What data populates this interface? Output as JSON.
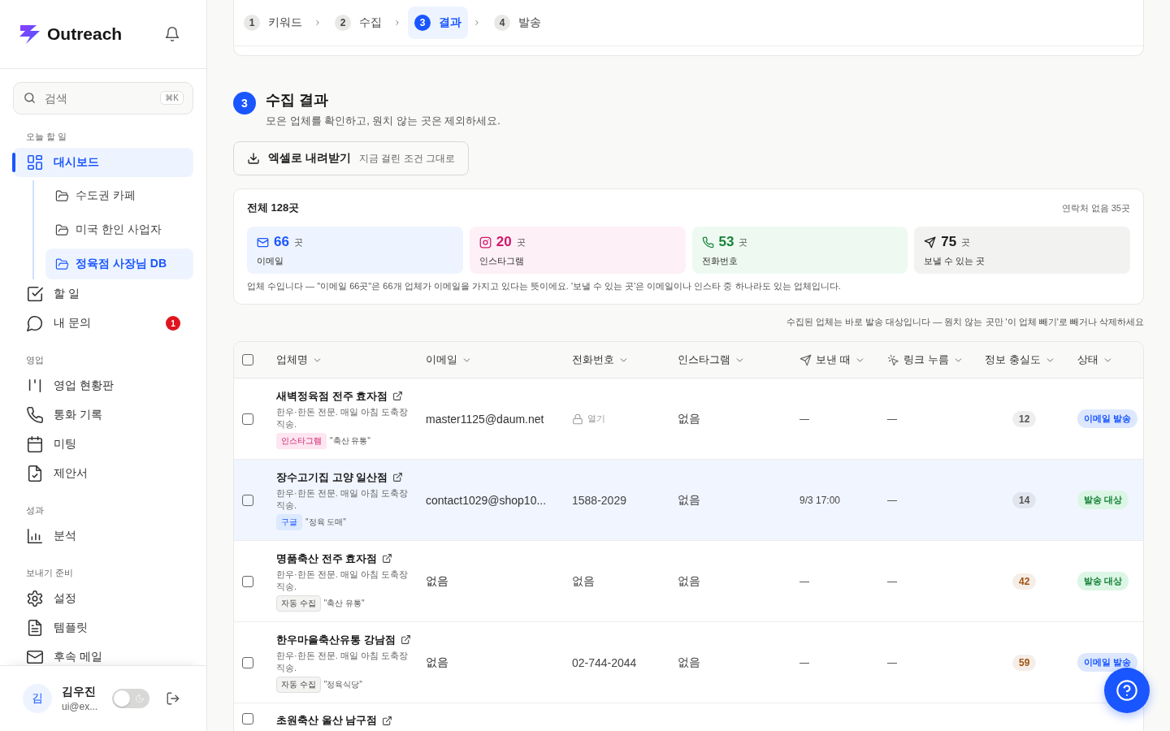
{
  "sidebar": {
    "brand": "Outreach",
    "search": {
      "placeholder": "검색",
      "shortcut": "⌘K"
    },
    "sections": [
      {
        "label": "오늘 할 일",
        "items": [
          {
            "label": "대시보드",
            "selected": true,
            "children": [
              {
                "label": "수도권 카페",
                "selected": false
              },
              {
                "label": "미국 한인 사업자",
                "selected": false
              },
              {
                "label": "정육점 사장님 DB",
                "selected": true
              }
            ]
          },
          {
            "label": "할 일",
            "selected": false
          },
          {
            "label": "내 문의",
            "selected": false,
            "badge": "1"
          }
        ]
      },
      {
        "label": "영업",
        "items": [
          {
            "label": "영업 현황판",
            "selected": false
          },
          {
            "label": "통화 기록",
            "selected": false
          },
          {
            "label": "미팅",
            "selected": false
          },
          {
            "label": "제안서",
            "selected": false
          }
        ]
      },
      {
        "label": "성과",
        "items": [
          {
            "label": "분석",
            "selected": false
          }
        ]
      },
      {
        "label": "보내기 준비",
        "items": [
          {
            "label": "설정",
            "selected": false
          },
          {
            "label": "템플릿",
            "selected": false
          },
          {
            "label": "후속 메일",
            "selected": false
          }
        ]
      }
    ],
    "user": {
      "initial": "김",
      "name": "김우진",
      "email": "ui@ex...",
      "dark_mode": false
    }
  },
  "steps": [
    {
      "number": "1",
      "label": "키워드",
      "selected": false
    },
    {
      "number": "2",
      "label": "수집",
      "selected": false
    },
    {
      "number": "3",
      "label": "결과",
      "selected": true
    },
    {
      "number": "4",
      "label": "발송",
      "selected": false
    }
  ],
  "section": {
    "number": "3",
    "title": "수집 결과",
    "subtitle": "모은 업체를 확인하고, 원치 않는 곳은 제외하세요.",
    "export_button": {
      "label": "엑셀로 내려받기",
      "hint": "지금 걸린 조건 그대로"
    }
  },
  "summary": {
    "title": "전체 128곳",
    "aside": "연락처 없음 35곳",
    "stats": [
      {
        "kind": "email",
        "value": "66",
        "unit": "곳",
        "label": "이메일"
      },
      {
        "kind": "instagram",
        "value": "20",
        "unit": "곳",
        "label": "인스타그램"
      },
      {
        "kind": "phone",
        "value": "53",
        "unit": "곳",
        "label": "전화번호"
      },
      {
        "kind": "send",
        "value": "75",
        "unit": "곳",
        "label": "보낼 수 있는 곳"
      }
    ],
    "note": "업체 수입니다 — \"이메일 66곳\"은 66개 업체가 이메일을 가지고 있다는 뜻이에요. '보낼 수 있는 곳'은 이메일이나 인스타 중 하나라도 있는 업체입니다."
  },
  "table_note": "수집된 업체는 바로 발송 대상입니다 — 원치 않는 곳만 '이 업체 빼기'로 빼거나 삭제하세요",
  "table": {
    "all_checked": false,
    "columns": [
      {
        "kind": "name",
        "label": "업체명"
      },
      {
        "kind": "email",
        "label": "이메일"
      },
      {
        "kind": "phone",
        "label": "전화번호"
      },
      {
        "kind": "instagram",
        "label": "인스타그램"
      },
      {
        "kind": "sent",
        "label": "보낸 때"
      },
      {
        "kind": "clicks",
        "label": "링크 누름"
      },
      {
        "kind": "score",
        "label": "정보 충실도"
      },
      {
        "kind": "status",
        "label": "상태"
      }
    ],
    "rows": [
      {
        "checked": false,
        "highlighted": false,
        "name": "새벽정육점 전주 효자점",
        "description": "한우·한돈 전문. 매일 아침 도축장 직송.",
        "tag": {
          "kind": "instagram",
          "label": "인스타그램"
        },
        "keyword": "\"축산 유통\"",
        "email": "master1125@daum.net",
        "phone": {
          "text": "열기",
          "locked": true
        },
        "instagram": "없음",
        "sent": "—",
        "clicks": "—",
        "score": {
          "text": "12",
          "color": "#555555"
        },
        "status": {
          "kind": "email",
          "label": "이메일 발송"
        }
      },
      {
        "checked": false,
        "highlighted": true,
        "name": "장수고기집 고양 일산점",
        "description": "한우·한돈 전문. 매일 아침 도축장 직송.",
        "tag": {
          "kind": "google",
          "label": "구글"
        },
        "keyword": "\"정육 도매\"",
        "email": "contact1029@shop10...",
        "phone": {
          "text": "1588-2029",
          "locked": false
        },
        "instagram": "없음",
        "sent": "9/3 17:00",
        "clicks": "—",
        "score": {
          "text": "14",
          "color": "#555555"
        },
        "status": {
          "kind": "target",
          "label": "발송 대상"
        }
      },
      {
        "checked": false,
        "highlighted": false,
        "name": "명품축산 전주 효자점",
        "description": "한우·한돈 전문. 매일 아침 도축장 직송.",
        "tag": {
          "kind": "auto",
          "label": "자동 수집"
        },
        "keyword": "\"축산 유통\"",
        "email": "없음",
        "phone": {
          "text": "없음",
          "locked": false
        },
        "instagram": "없음",
        "sent": "—",
        "clicks": "—",
        "score": {
          "text": "42",
          "color": "#a0520f"
        },
        "status": {
          "kind": "target",
          "label": "발송 대상"
        }
      },
      {
        "checked": false,
        "highlighted": false,
        "name": "한우마을축산유통 강남점",
        "description": "한우·한돈 전문. 매일 아침 도축장 직송.",
        "tag": {
          "kind": "auto",
          "label": "자동 수집"
        },
        "keyword": "\"정육식당\"",
        "email": "없음",
        "phone": {
          "text": "02-744-2044",
          "locked": false
        },
        "instagram": "없음",
        "sent": "—",
        "clicks": "—",
        "score": {
          "text": "59",
          "color": "#a0520f"
        },
        "status": {
          "kind": "email",
          "label": "이메일 발송"
        }
      },
      {
        "checked": false,
        "highlighted": false,
        "name": "초원축산 울산 남구점"
      }
    ]
  }
}
